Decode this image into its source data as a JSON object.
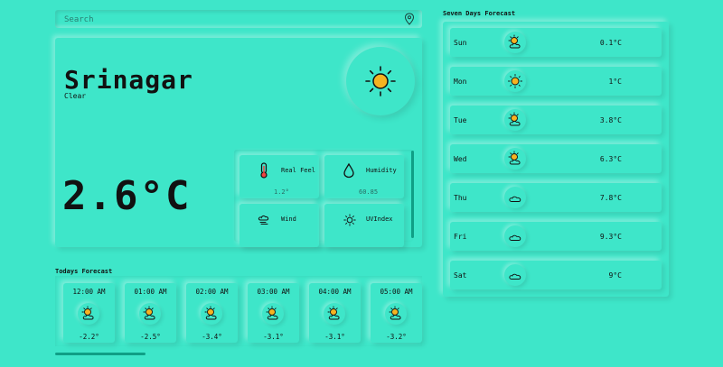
{
  "search": {
    "placeholder": "Search"
  },
  "current": {
    "city": "Srinagar",
    "condition": "Clear",
    "temperature": "2.6°C",
    "details": [
      {
        "label": "Real Feel",
        "value": "1.2°",
        "icon": "thermometer-icon"
      },
      {
        "label": "Humidity",
        "value": "60.85",
        "icon": "droplet-icon"
      },
      {
        "label": "Wind",
        "value": "",
        "icon": "wind-icon"
      },
      {
        "label": "UVIndex",
        "value": "",
        "icon": "sun-small-icon"
      }
    ]
  },
  "today": {
    "title": "Todays Forecast",
    "hours": [
      {
        "time": "12:00 AM",
        "temp": "-2.2°"
      },
      {
        "time": "01:00 AM",
        "temp": "-2.5°"
      },
      {
        "time": "02:00 AM",
        "temp": "-3.4°"
      },
      {
        "time": "03:00 AM",
        "temp": "-3.1°"
      },
      {
        "time": "04:00 AM",
        "temp": "-3.1°"
      },
      {
        "time": "05:00 AM",
        "temp": "-3.2°"
      }
    ]
  },
  "week": {
    "title": "Seven Days Forecast",
    "days": [
      {
        "day": "Sun",
        "temp": "0.1°C",
        "icon": "partly-cloudy-icon"
      },
      {
        "day": "Mon",
        "temp": "1°C",
        "icon": "sun-icon"
      },
      {
        "day": "Tue",
        "temp": "3.8°C",
        "icon": "partly-cloudy-icon"
      },
      {
        "day": "Wed",
        "temp": "6.3°C",
        "icon": "partly-cloudy-icon"
      },
      {
        "day": "Thu",
        "temp": "7.8°C",
        "icon": "cloud-icon"
      },
      {
        "day": "Fri",
        "temp": "9.3°C",
        "icon": "cloud-icon"
      },
      {
        "day": "Sat",
        "temp": "9°C",
        "icon": "cloud-icon"
      }
    ]
  },
  "colors": {
    "background": "#3ee6c9",
    "accent": "#0f9f86",
    "sun": "#f5b321"
  }
}
